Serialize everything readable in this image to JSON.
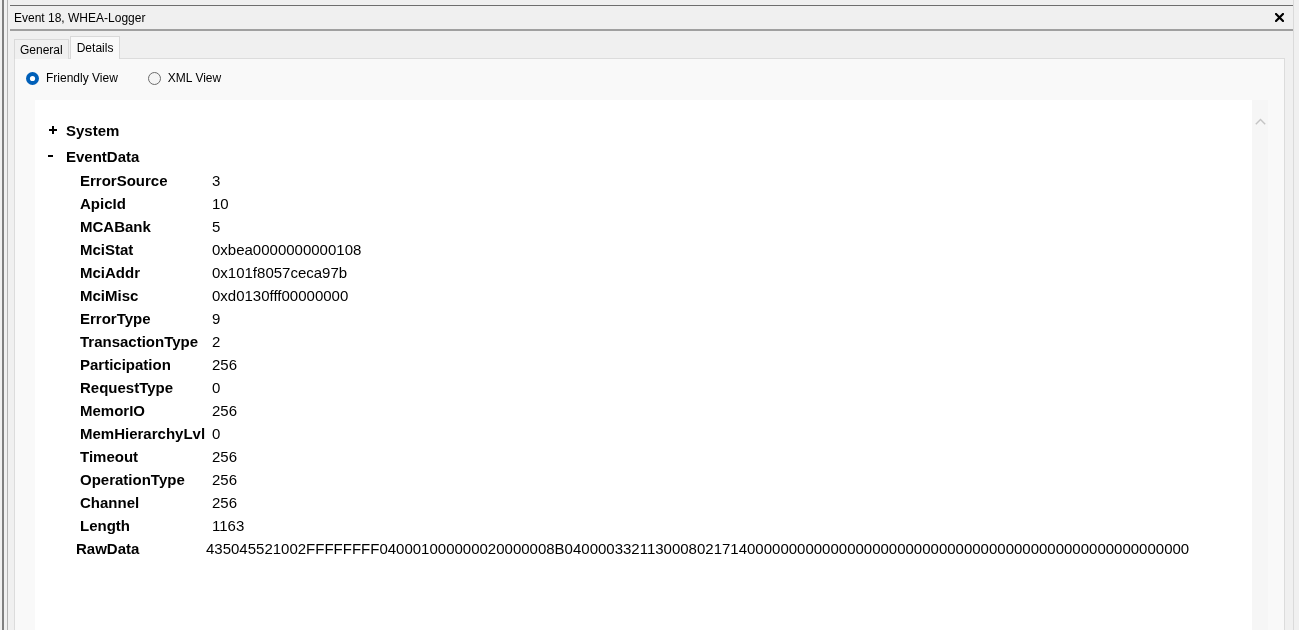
{
  "window": {
    "title": "Event 18, WHEA-Logger"
  },
  "tabs": [
    {
      "label": "General",
      "selected": false
    },
    {
      "label": "Details",
      "selected": true
    }
  ],
  "view_options": [
    {
      "label": "Friendly View",
      "selected": true
    },
    {
      "label": "XML View",
      "selected": false
    }
  ],
  "tree": [
    {
      "label": "System",
      "expanded": false
    },
    {
      "label": "EventData",
      "expanded": true,
      "children": [
        {
          "name": "ErrorSource",
          "value": "3"
        },
        {
          "name": "ApicId",
          "value": "10"
        },
        {
          "name": "MCABank",
          "value": "5"
        },
        {
          "name": "MciStat",
          "value": "0xbea0000000000108"
        },
        {
          "name": "MciAddr",
          "value": "0x101f8057ceca97b"
        },
        {
          "name": "MciMisc",
          "value": "0xd0130fff00000000"
        },
        {
          "name": "ErrorType",
          "value": "9"
        },
        {
          "name": "TransactionType",
          "value": "2"
        },
        {
          "name": "Participation",
          "value": "256"
        },
        {
          "name": "RequestType",
          "value": "0"
        },
        {
          "name": "MemorIO",
          "value": "256"
        },
        {
          "name": "MemHierarchyLvl",
          "value": "0"
        },
        {
          "name": "Timeout",
          "value": "256"
        },
        {
          "name": "OperationType",
          "value": "256"
        },
        {
          "name": "Channel",
          "value": "256"
        },
        {
          "name": "Length",
          "value": "1163"
        }
      ],
      "raw_data": {
        "name": "RawData",
        "value": "435045521002FFFFFFFF040001000000020000008B040000332113000802171400000000000000000000000000000000000000000000000000000"
      }
    }
  ]
}
